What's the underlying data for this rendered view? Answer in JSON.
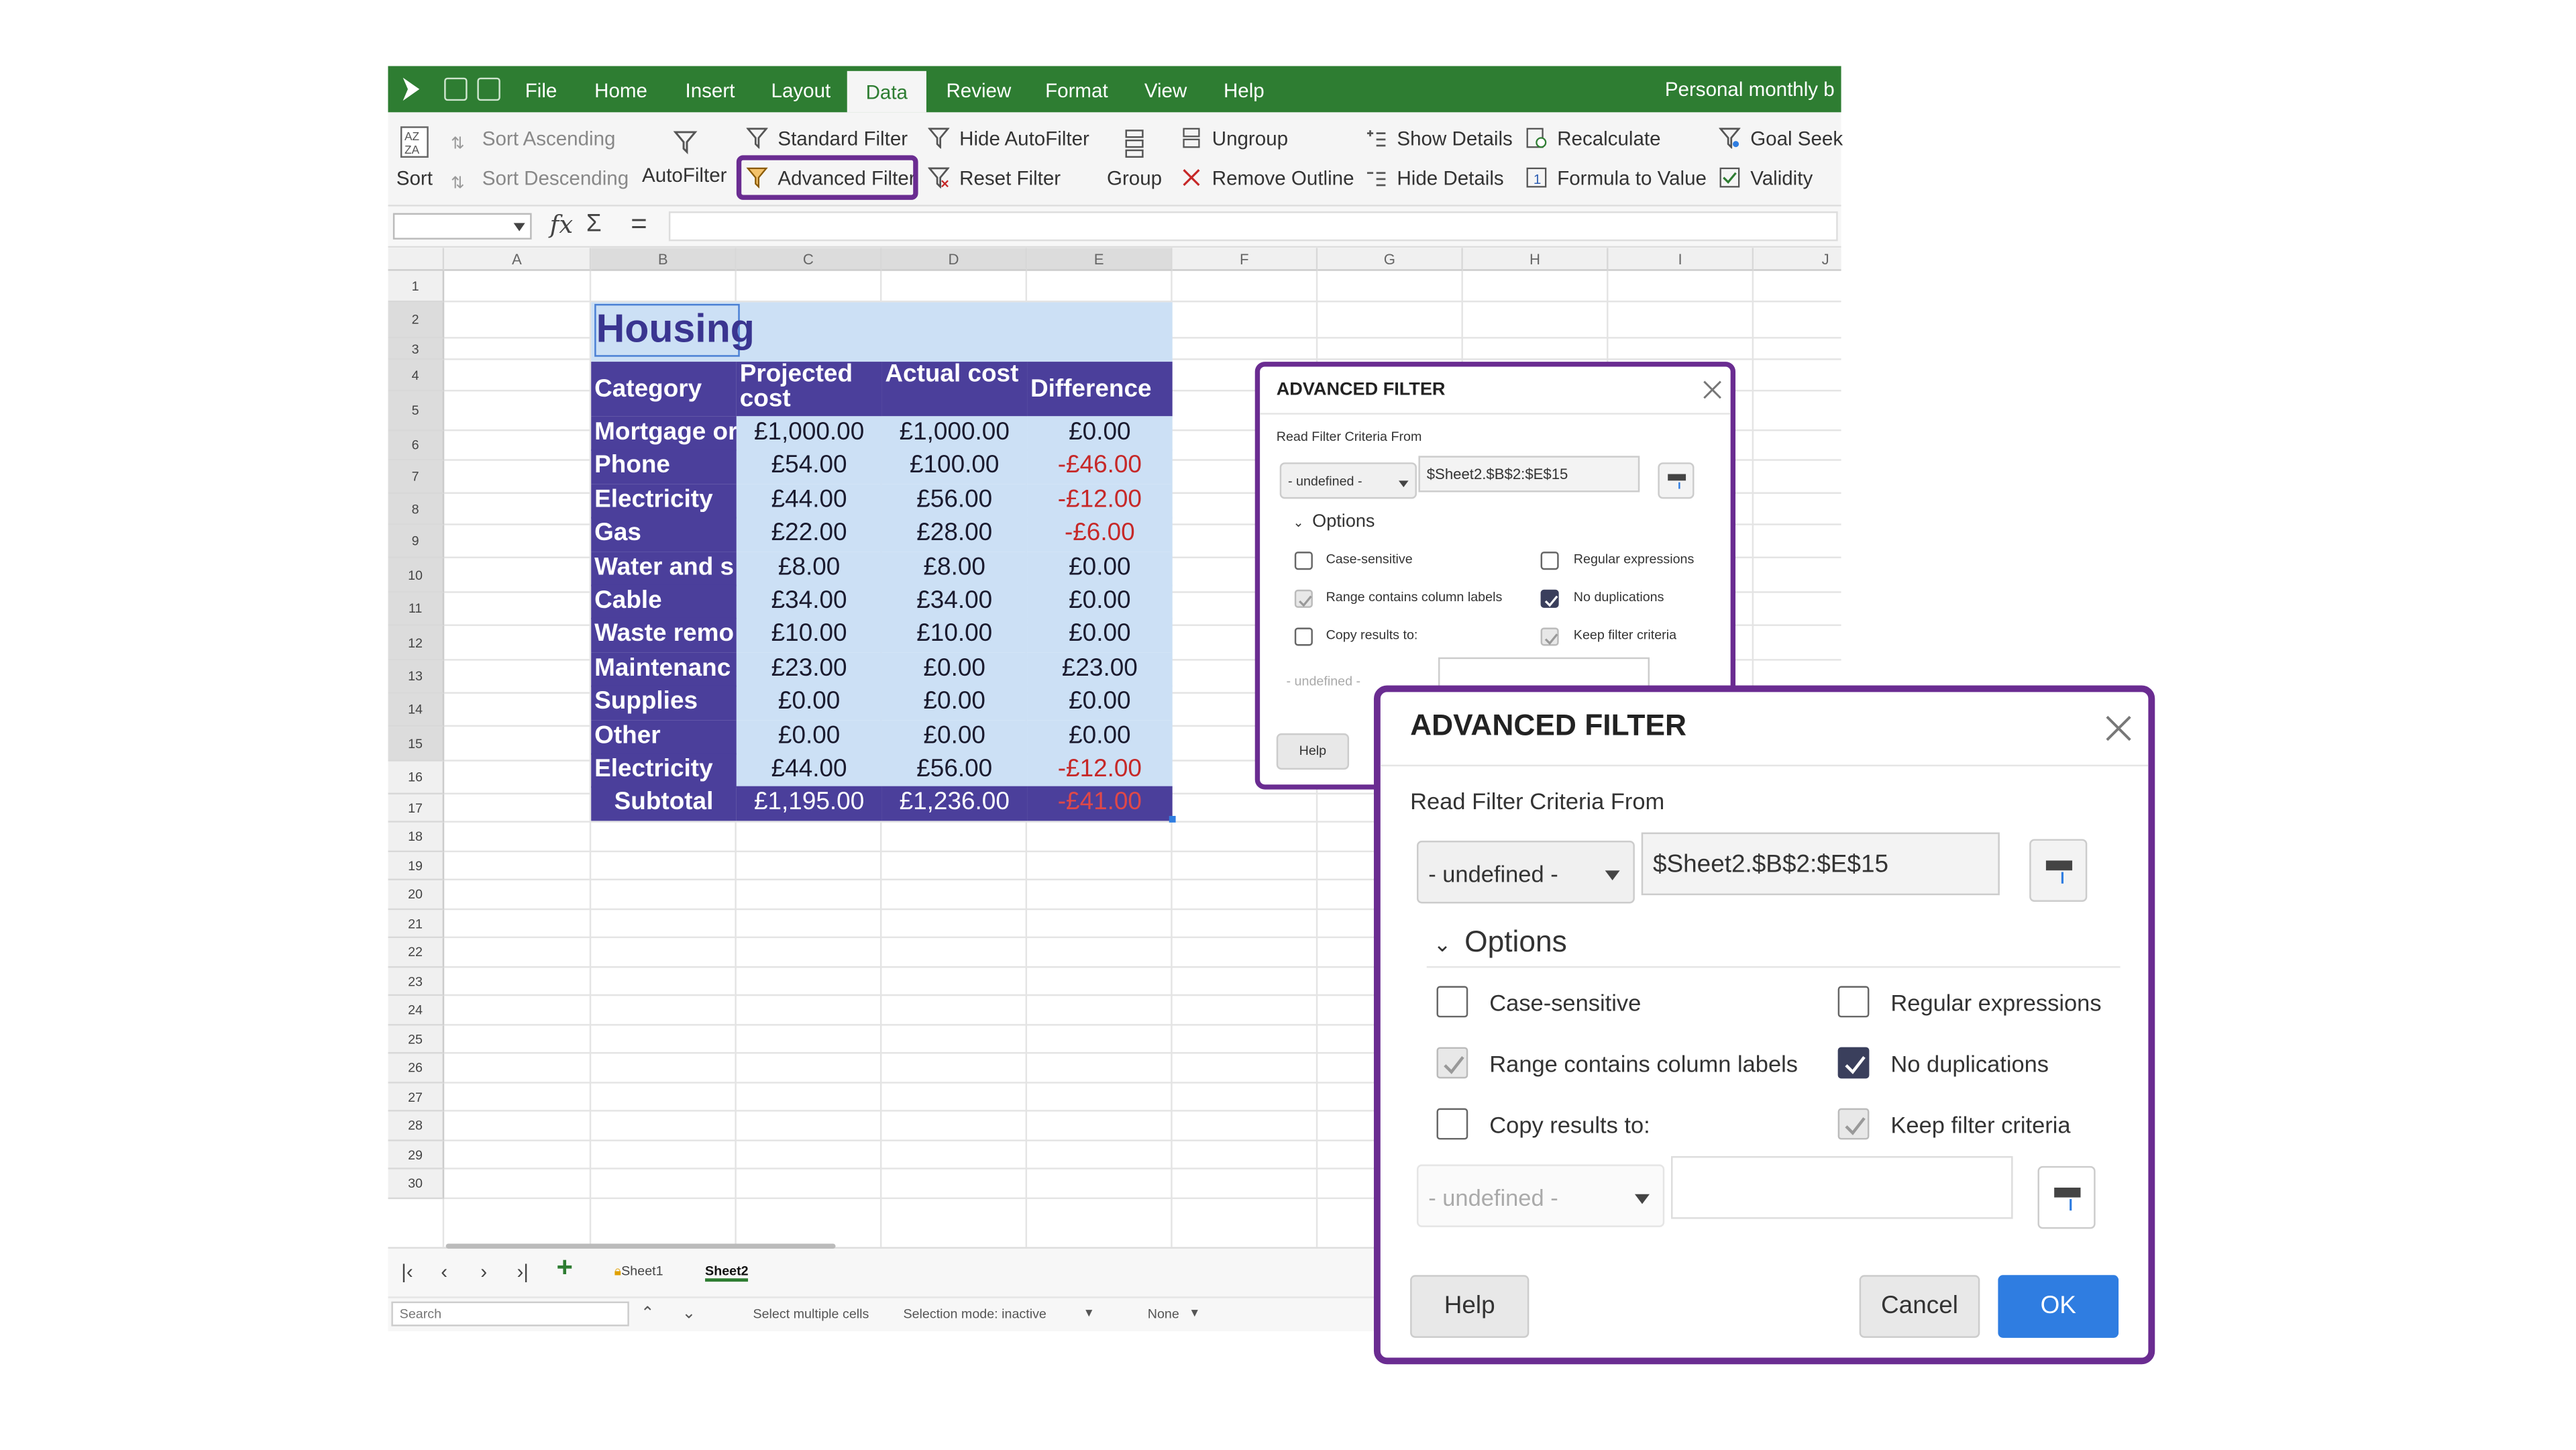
{
  "titlebar": {
    "menus": [
      "File",
      "Home",
      "Insert",
      "Layout",
      "Data",
      "Review",
      "Format",
      "View",
      "Help"
    ],
    "active_tab": "Data",
    "document_title": "Personal monthly b"
  },
  "ribbon": {
    "sort": "Sort",
    "sort_ascending": "Sort Ascending",
    "sort_descending": "Sort Descending",
    "autofilter": "AutoFilter",
    "standard_filter": "Standard Filter",
    "advanced_filter": "Advanced Filter",
    "hide_autofilter": "Hide AutoFilter",
    "reset_filter": "Reset Filter",
    "group": "Group",
    "ungroup": "Ungroup",
    "remove_outline": "Remove Outline",
    "show_details": "Show Details",
    "hide_details": "Hide Details",
    "recalculate": "Recalculate",
    "formula_to_value": "Formula to Value",
    "goal_seek": "Goal Seek",
    "validity": "Validity"
  },
  "formula_bar": {
    "fx": "fx",
    "sum": "Σ",
    "equals": "="
  },
  "columns": [
    "A",
    "B",
    "C",
    "D",
    "E",
    "F",
    "G",
    "H",
    "I",
    "J"
  ],
  "rows": [
    "1",
    "2",
    "3",
    "4",
    "5",
    "6",
    "7",
    "8",
    "9",
    "10",
    "11",
    "12",
    "13",
    "14",
    "15",
    "16",
    "17",
    "18",
    "19",
    "20",
    "21",
    "22",
    "23",
    "24",
    "25",
    "26",
    "27",
    "28",
    "29",
    "30"
  ],
  "sheet": {
    "title": "Housing",
    "headers": {
      "category": "Category",
      "projected": "Projected cost",
      "actual": "Actual cost",
      "difference": "Difference"
    },
    "data_rows": [
      {
        "category": "Mortgage or",
        "projected": "£1,000.00",
        "actual": "£1,000.00",
        "difference": "£0.00",
        "negative": false
      },
      {
        "category": "Phone",
        "projected": "£54.00",
        "actual": "£100.00",
        "difference": "-£46.00",
        "negative": true
      },
      {
        "category": "Electricity",
        "projected": "£44.00",
        "actual": "£56.00",
        "difference": "-£12.00",
        "negative": true
      },
      {
        "category": "Gas",
        "projected": "£22.00",
        "actual": "£28.00",
        "difference": "-£6.00",
        "negative": true
      },
      {
        "category": "Water and s",
        "projected": "£8.00",
        "actual": "£8.00",
        "difference": "£0.00",
        "negative": false
      },
      {
        "category": "Cable",
        "projected": "£34.00",
        "actual": "£34.00",
        "difference": "£0.00",
        "negative": false
      },
      {
        "category": "Waste remo",
        "projected": "£10.00",
        "actual": "£10.00",
        "difference": "£0.00",
        "negative": false
      },
      {
        "category": "Maintenanc",
        "projected": "£23.00",
        "actual": "£0.00",
        "difference": "£23.00",
        "negative": false
      },
      {
        "category": "Supplies",
        "projected": "£0.00",
        "actual": "£0.00",
        "difference": "£0.00",
        "negative": false
      },
      {
        "category": "Other",
        "projected": "£0.00",
        "actual": "£0.00",
        "difference": "£0.00",
        "negative": false
      },
      {
        "category": "Electricity",
        "projected": "£44.00",
        "actual": "£56.00",
        "difference": "-£12.00",
        "negative": true
      }
    ],
    "subtotal": {
      "label": "Subtotal",
      "projected": "£1,195.00",
      "actual": "£1,236.00",
      "difference": "-£41.00"
    }
  },
  "sheet_tabs": {
    "tabs": [
      "Sheet1",
      "Sheet2"
    ],
    "active": "Sheet2",
    "add": "+"
  },
  "statusbar": {
    "search_placeholder": "Search",
    "select_mode": "Select multiple cells",
    "selection_mode": "Selection mode: inactive",
    "zoom": "None"
  },
  "dialog": {
    "title": "ADVANCED FILTER",
    "criteria_label": "Read Filter Criteria From",
    "criteria_select": "- undefined -",
    "criteria_range": "$Sheet2.$B$2:$E$15",
    "options_header": "Options",
    "options": {
      "case_sensitive": "Case-sensitive",
      "regular_expressions": "Regular expressions",
      "range_contains_labels": "Range contains column labels",
      "no_duplications": "No duplications",
      "copy_results": "Copy results to:",
      "keep_filter_criteria": "Keep filter criteria"
    },
    "copy_select": "- undefined -",
    "help": "Help",
    "cancel": "Cancel",
    "ok": "OK"
  },
  "colors": {
    "titlebar": "#2e7d32",
    "accent_purple": "#6a2c91",
    "category_fill": "#4b3f9b",
    "value_fill": "#cce0f5",
    "negative_text": "#c62828",
    "ok_button": "#2f7de1"
  }
}
